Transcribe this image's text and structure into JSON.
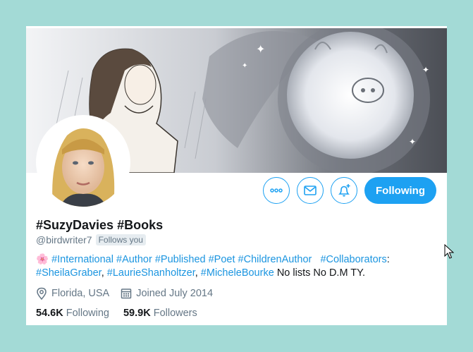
{
  "profile": {
    "name": "#SuzyDavies #Books",
    "handle": "@birdwriter7",
    "follows_you": "Follows you",
    "follow_button": "Following",
    "bio": {
      "emoji": "🌸",
      "line1_tags": [
        "#International",
        "#Author",
        "#Published",
        "#Poet",
        "#ChildrenAuthor"
      ],
      "collab_tag": "#Collaborators",
      "collab_colon": ":",
      "collab_tags": [
        "#SheilaGraber",
        "#LaurieShanholtzer",
        "#MicheleBourke"
      ],
      "tail": "No lists No D.M TY."
    },
    "location": "Florida, USA",
    "joined": "Joined July 2014",
    "following_count": "54.6K",
    "following_label": "Following",
    "followers_count": "59.9K",
    "followers_label": "Followers"
  },
  "colors": {
    "accent": "#1da1f2",
    "link": "#1b95e0",
    "page_bg": "#a3dad6"
  },
  "icons": [
    "more-icon",
    "mail-icon",
    "bell-plus-icon",
    "location-icon",
    "calendar-icon",
    "cursor-icon"
  ]
}
